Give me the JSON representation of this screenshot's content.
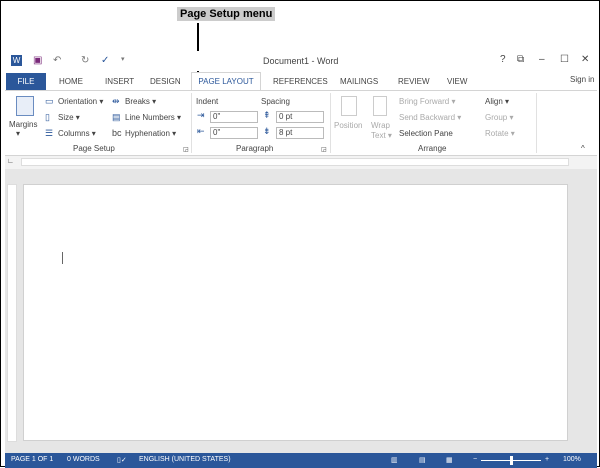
{
  "annotation": "Page Setup menu",
  "title": "Document1 - Word",
  "window": {
    "help": "?",
    "restore": "⧉",
    "minimize": "–",
    "maximize": "☐",
    "close": "✕"
  },
  "tabs": [
    "FILE",
    "HOME",
    "INSERT",
    "DESIGN",
    "PAGE LAYOUT",
    "REFERENCES",
    "MAILINGS",
    "REVIEW",
    "VIEW"
  ],
  "sign_in": "Sign in",
  "page_setup": {
    "margins": "Margins",
    "orientation": "Orientation ▾",
    "size": "Size ▾",
    "columns": "Columns ▾",
    "breaks": "Breaks ▾",
    "line_numbers": "Line Numbers ▾",
    "hyphenation": "Hyphenation ▾",
    "group": "Page Setup"
  },
  "paragraph": {
    "indent": "Indent",
    "spacing": "Spacing",
    "indent_left": "0\"",
    "indent_right": "0\"",
    "spacing_before": "0 pt",
    "spacing_after": "8 pt",
    "group": "Paragraph"
  },
  "arrange": {
    "position": "Position",
    "wrap_text": "Wrap",
    "wrap_text2": "Text ▾",
    "bring_forward": "Bring Forward ▾",
    "send_backward": "Send Backward ▾",
    "selection_pane": "Selection Pane",
    "align": "Align ▾",
    "group_btn": "Group ▾",
    "rotate": "Rotate ▾",
    "group": "Arrange"
  },
  "status": {
    "page": "PAGE 1 OF 1",
    "words": "0 WORDS",
    "language": "ENGLISH (UNITED STATES)",
    "zoom": "100%",
    "zoom_fraction": 0.5
  }
}
